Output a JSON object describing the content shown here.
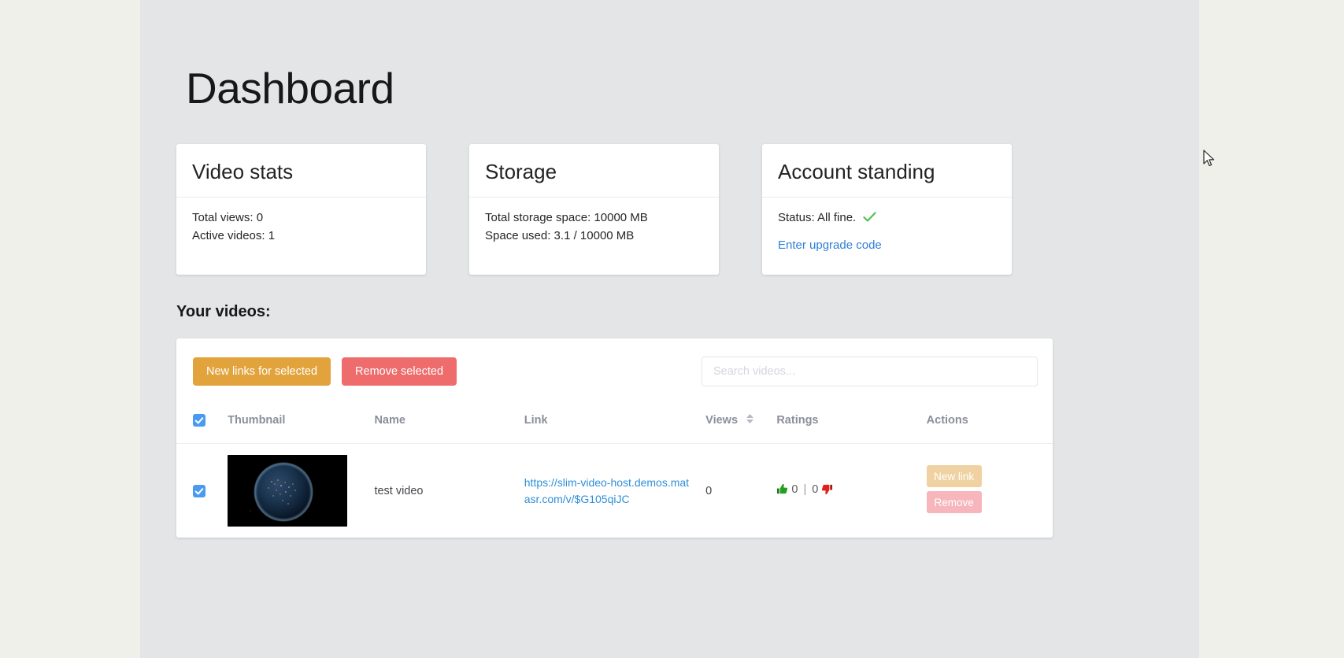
{
  "page": {
    "title": "Dashboard"
  },
  "cards": [
    {
      "name": "video-stats",
      "title": "Video stats",
      "lines": [
        "Total views: 0",
        "Active videos: 1"
      ]
    },
    {
      "name": "storage",
      "title": "Storage",
      "lines": [
        "Total storage space: 10000 MB",
        "Space used: 3.1 / 10000 MB"
      ]
    },
    {
      "name": "account-standing",
      "title": "Account standing",
      "status_label": "Status: All fine.",
      "status_icon": "green-check-icon",
      "link_label": "Enter upgrade code"
    }
  ],
  "videos_section": {
    "heading": "Your videos:",
    "toolbar": {
      "new_links_label": "New links for selected",
      "remove_selected_label": "Remove selected",
      "search_placeholder": "Search videos...",
      "search_value": ""
    },
    "table": {
      "headers": {
        "thumbnail": "Thumbnail",
        "name": "Name",
        "link": "Link",
        "views": "Views",
        "ratings": "Ratings",
        "actions": "Actions"
      },
      "header_select_all_checked": true,
      "views_sort_icon": "sort-updown-icon",
      "rows": [
        {
          "selected": true,
          "thumbnail_alt": "earth-at-night-thumbnail",
          "name": "test video",
          "link": "https://slim-video-host.demos.matasr.com/v/$G105qiJC",
          "views": "0",
          "ratings": {
            "up_icon": "thumbs-up-icon",
            "up_count": "0",
            "separator": "|",
            "down_count": "0",
            "down_icon": "thumbs-down-icon"
          },
          "actions": {
            "new_link_label": "New link",
            "remove_label": "Remove"
          }
        }
      ]
    }
  },
  "colors": {
    "page_background": "#e4e5e7",
    "outer_background": "#eff0ea",
    "accent_orange": "#e2a33c",
    "accent_red": "#ee6c6c",
    "accent_orange_muted": "#f0d2a2",
    "accent_red_muted": "#f6b6bb",
    "link_blue": "#2f8fd8",
    "checkbox_blue": "#4a9bf0",
    "status_green": "#52c152",
    "thumbs_up_green": "#1a9a1a",
    "thumbs_down_red": "#e0211a"
  }
}
